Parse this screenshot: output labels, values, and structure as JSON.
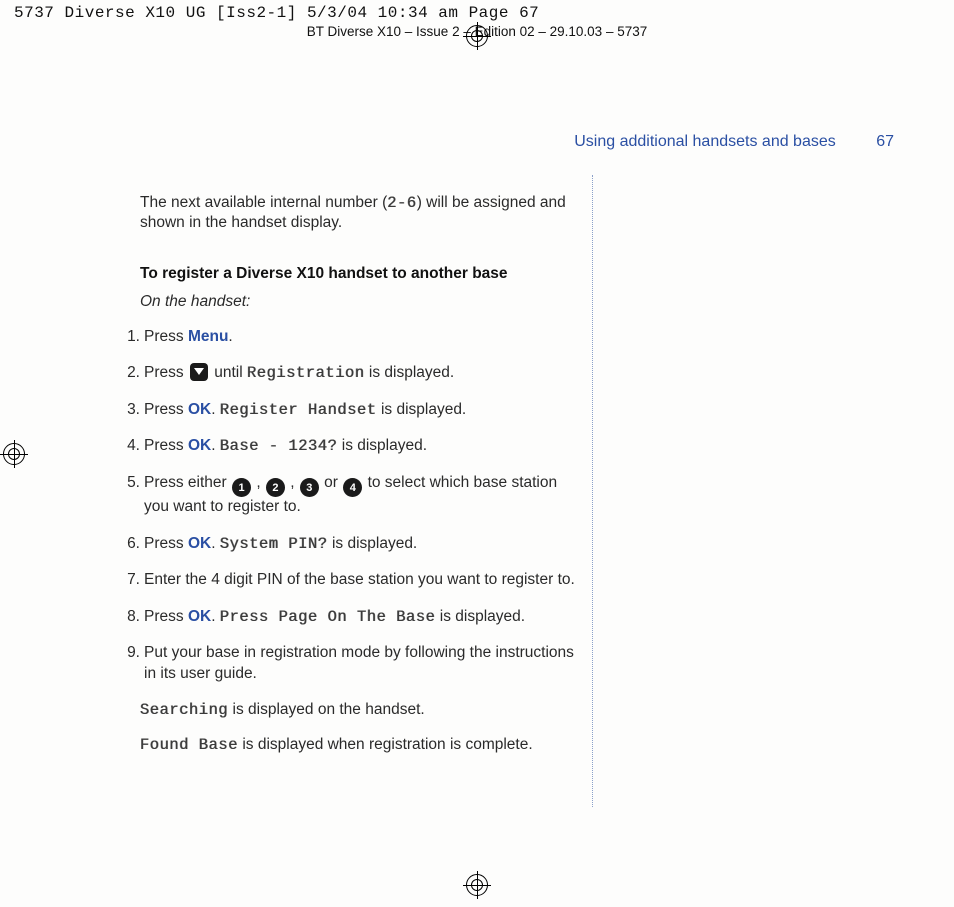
{
  "imposition_slug": "5737 Diverse X10 UG [Iss2-1]  5/3/04  10:34 am  Page 67",
  "running_head": "BT Diverse X10 – Issue 2 – Edition 02 – 29.10.03 – 5737",
  "header": {
    "section_title": "Using additional handsets and bases",
    "page_number": "67"
  },
  "intro_a": "The next available internal number (",
  "intro_range": "2-6",
  "intro_b": ") will be assigned and shown in the handset display.",
  "sub_heading": "To register a Diverse X10 handset to another base",
  "context_line": "On the handset:",
  "softkeys": {
    "menu": "Menu",
    "ok": "OK"
  },
  "keypad": {
    "k1": "1",
    "k2": "2",
    "k3": "3",
    "k4": "4"
  },
  "lcd": {
    "registration": "Registration",
    "register_handset": "Register Handset",
    "base_1234": "Base - 1234?",
    "system_pin": "System PIN?",
    "press_page": "Press Page On The Base",
    "searching": "Searching",
    "found_base": "Found Base"
  },
  "steps": {
    "s1": {
      "num": "1.",
      "a": "Press ",
      "b": "."
    },
    "s2": {
      "num": "2.",
      "a": "Press ",
      "b": " until ",
      "c": " is displayed."
    },
    "s3": {
      "num": "3.",
      "a": "Press ",
      "b": ". ",
      "c": " is displayed."
    },
    "s4": {
      "num": "4.",
      "a": "Press ",
      "b": ". ",
      "c": " is displayed."
    },
    "s5": {
      "num": "5.",
      "a": "Press either ",
      "b": " , ",
      "c": " , ",
      "d": " or ",
      "e": " to select which base station you want to register to."
    },
    "s6": {
      "num": "6.",
      "a": "Press ",
      "b": ". ",
      "c": " is displayed."
    },
    "s7": {
      "num": "7.",
      "a": "Enter the 4 digit PIN of the base station you want to register to."
    },
    "s8": {
      "num": "8.",
      "a": "Press ",
      "b": ". ",
      "c": " is displayed."
    },
    "s9": {
      "num": "9.",
      "a": "Put your base in registration mode by following the instructions in its user guide."
    }
  },
  "tail1_b": " is displayed on the handset.",
  "tail2_b": " is displayed when registration is complete."
}
